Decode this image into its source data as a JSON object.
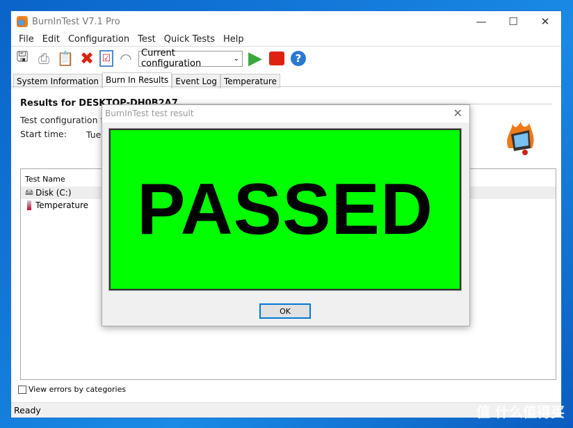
{
  "window": {
    "title": "BurnInTest V7.1 Pro",
    "minimize": "—",
    "maximize": "☐",
    "close": "✕"
  },
  "menu": [
    "File",
    "Edit",
    "Configuration",
    "Test",
    "Quick Tests",
    "Help"
  ],
  "toolbar": {
    "config_select": "Current configuration"
  },
  "tabs": [
    "System Information",
    "Burn In Results",
    "Event Log",
    "Temperature"
  ],
  "results": {
    "title": "Results for DESKTOP-DH0B2A7",
    "config_label": "Test configuration file",
    "start_label": "Start time:",
    "start_value_partial": "Tue",
    "right_partial": "s"
  },
  "list": {
    "header": "Test Name",
    "rows": [
      "Disk (C:)",
      "Temperature"
    ]
  },
  "checkbox": {
    "label": "View errors by categories",
    "checked": false
  },
  "status": "Ready",
  "dialog": {
    "title": "BurnInTest test result",
    "result": "PASSED",
    "ok": "OK",
    "result_color": "#00ff00"
  },
  "watermark": "值 什么值得买"
}
